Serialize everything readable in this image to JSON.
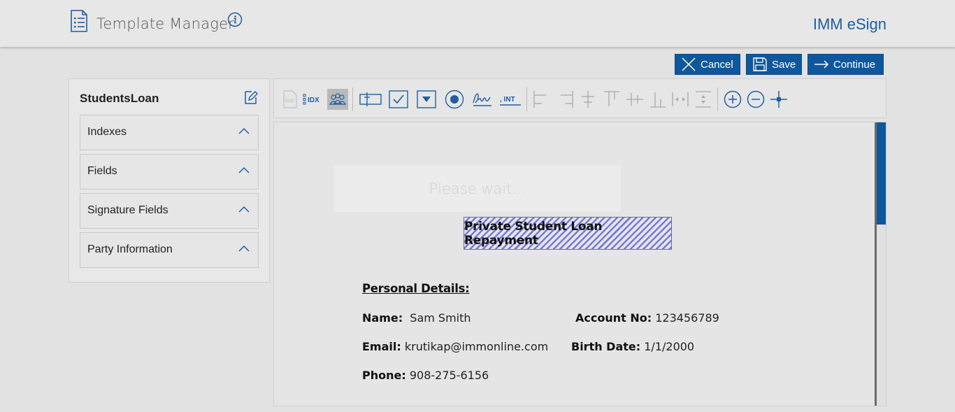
{
  "header": {
    "title": "Template Manager",
    "brand": "IMM eSign",
    "icons": [
      "document-list-icon",
      "info-icon"
    ]
  },
  "actions": {
    "cancel_label": "Cancel",
    "save_label": "Save",
    "continue_label": "Continue"
  },
  "sidebar": {
    "template_name": "StudentsLoan",
    "sections": [
      {
        "label": "Indexes"
      },
      {
        "label": "Fields"
      },
      {
        "label": "Signature Fields"
      },
      {
        "label": "Party Information"
      }
    ]
  },
  "toolbar": {
    "tools": [
      "doc-index-icon",
      "idx-icon",
      "parties-icon",
      "textbox-tool-icon",
      "checkbox-tool-icon",
      "dropdown-tool-icon",
      "radio-tool-icon",
      "signature-tool-icon",
      "initials-tool-icon",
      "align-left-icon",
      "align-right-icon",
      "align-center-h-icon",
      "align-top-icon",
      "align-middle-icon",
      "align-bottom-icon",
      "distribute-h-icon",
      "distribute-v-icon",
      "zoom-in-icon",
      "zoom-out-icon",
      "crosshair-icon"
    ],
    "idx_text": "IDX",
    "int_text": ", INT"
  },
  "document": {
    "wait_message": "Please wait...",
    "title": "Private Student Loan Repayment",
    "section_title": "Personal Details:",
    "fields": {
      "name_label": "Name:",
      "name_value": "Sam Smith",
      "account_label": "Account No:",
      "account_value": "123456789",
      "email_label": "Email:",
      "email_value": "krutikap@immonline.com",
      "birth_label": "Birth Date:",
      "birth_value": "1/1/2000",
      "phone_label": "Phone:",
      "phone_value": "908-275-6156"
    }
  },
  "colors": {
    "accent": "#0f579c",
    "brand_text": "#1f5fa0",
    "field_hatch": "#7a7ad0"
  }
}
